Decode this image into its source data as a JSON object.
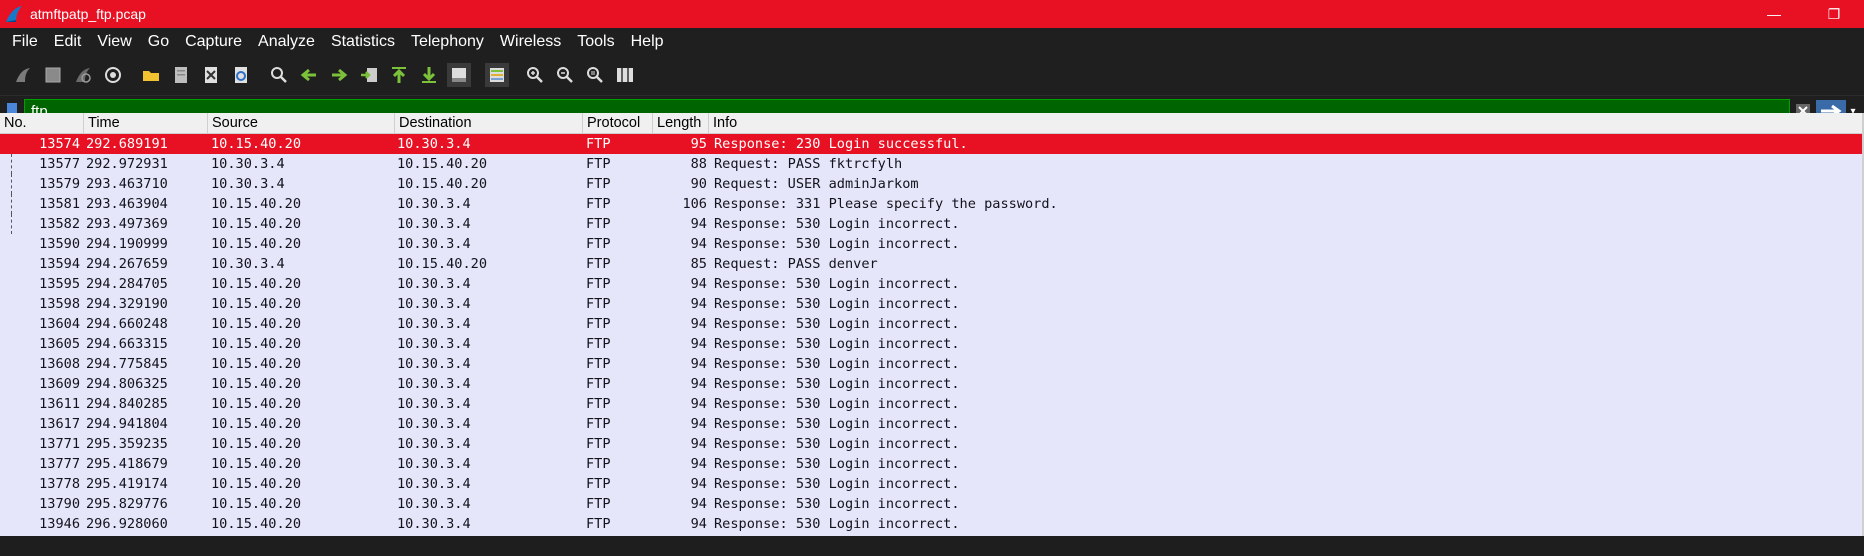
{
  "window": {
    "title": "atmftpatp_ftp.pcap",
    "minimize_glyph": "—",
    "maximize_glyph": "❐"
  },
  "menu": [
    "File",
    "Edit",
    "View",
    "Go",
    "Capture",
    "Analyze",
    "Statistics",
    "Telephony",
    "Wireless",
    "Tools",
    "Help"
  ],
  "filter": {
    "value": "ftp",
    "color": "#006400"
  },
  "columns": [
    "No.",
    "Time",
    "Source",
    "Destination",
    "Protocol",
    "Length",
    "Info"
  ],
  "packets": [
    {
      "no": "13574",
      "time": "292.689191",
      "src": "10.15.40.20",
      "dst": "10.30.3.4",
      "proto": "FTP",
      "len": "95",
      "info": "Response: 230 Login successful.",
      "selected": true
    },
    {
      "no": "13577",
      "time": "292.972931",
      "src": "10.30.3.4",
      "dst": "10.15.40.20",
      "proto": "FTP",
      "len": "88",
      "info": "Request: PASS fktrcfylh"
    },
    {
      "no": "13579",
      "time": "293.463710",
      "src": "10.30.3.4",
      "dst": "10.15.40.20",
      "proto": "FTP",
      "len": "90",
      "info": "Request: USER adminJarkom"
    },
    {
      "no": "13581",
      "time": "293.463904",
      "src": "10.15.40.20",
      "dst": "10.30.3.4",
      "proto": "FTP",
      "len": "106",
      "info": "Response: 331 Please specify the password."
    },
    {
      "no": "13582",
      "time": "293.497369",
      "src": "10.15.40.20",
      "dst": "10.30.3.4",
      "proto": "FTP",
      "len": "94",
      "info": "Response: 530 Login incorrect."
    },
    {
      "no": "13590",
      "time": "294.190999",
      "src": "10.15.40.20",
      "dst": "10.30.3.4",
      "proto": "FTP",
      "len": "94",
      "info": "Response: 530 Login incorrect."
    },
    {
      "no": "13594",
      "time": "294.267659",
      "src": "10.30.3.4",
      "dst": "10.15.40.20",
      "proto": "FTP",
      "len": "85",
      "info": "Request: PASS denver"
    },
    {
      "no": "13595",
      "time": "294.284705",
      "src": "10.15.40.20",
      "dst": "10.30.3.4",
      "proto": "FTP",
      "len": "94",
      "info": "Response: 530 Login incorrect."
    },
    {
      "no": "13598",
      "time": "294.329190",
      "src": "10.15.40.20",
      "dst": "10.30.3.4",
      "proto": "FTP",
      "len": "94",
      "info": "Response: 530 Login incorrect."
    },
    {
      "no": "13604",
      "time": "294.660248",
      "src": "10.15.40.20",
      "dst": "10.30.3.4",
      "proto": "FTP",
      "len": "94",
      "info": "Response: 530 Login incorrect."
    },
    {
      "no": "13605",
      "time": "294.663315",
      "src": "10.15.40.20",
      "dst": "10.30.3.4",
      "proto": "FTP",
      "len": "94",
      "info": "Response: 530 Login incorrect."
    },
    {
      "no": "13608",
      "time": "294.775845",
      "src": "10.15.40.20",
      "dst": "10.30.3.4",
      "proto": "FTP",
      "len": "94",
      "info": "Response: 530 Login incorrect."
    },
    {
      "no": "13609",
      "time": "294.806325",
      "src": "10.15.40.20",
      "dst": "10.30.3.4",
      "proto": "FTP",
      "len": "94",
      "info": "Response: 530 Login incorrect."
    },
    {
      "no": "13611",
      "time": "294.840285",
      "src": "10.15.40.20",
      "dst": "10.30.3.4",
      "proto": "FTP",
      "len": "94",
      "info": "Response: 530 Login incorrect."
    },
    {
      "no": "13617",
      "time": "294.941804",
      "src": "10.15.40.20",
      "dst": "10.30.3.4",
      "proto": "FTP",
      "len": "94",
      "info": "Response: 530 Login incorrect."
    },
    {
      "no": "13771",
      "time": "295.359235",
      "src": "10.15.40.20",
      "dst": "10.30.3.4",
      "proto": "FTP",
      "len": "94",
      "info": "Response: 530 Login incorrect."
    },
    {
      "no": "13777",
      "time": "295.418679",
      "src": "10.15.40.20",
      "dst": "10.30.3.4",
      "proto": "FTP",
      "len": "94",
      "info": "Response: 530 Login incorrect."
    },
    {
      "no": "13778",
      "time": "295.419174",
      "src": "10.15.40.20",
      "dst": "10.30.3.4",
      "proto": "FTP",
      "len": "94",
      "info": "Response: 530 Login incorrect."
    },
    {
      "no": "13790",
      "time": "295.829776",
      "src": "10.15.40.20",
      "dst": "10.30.3.4",
      "proto": "FTP",
      "len": "94",
      "info": "Response: 530 Login incorrect."
    },
    {
      "no": "13946",
      "time": "296.928060",
      "src": "10.15.40.20",
      "dst": "10.30.3.4",
      "proto": "FTP",
      "len": "94",
      "info": "Response: 530 Login incorrect."
    }
  ],
  "colors": {
    "title_bar": "#e81123",
    "row_bg": "#e6e6fa",
    "selected_row": "#e81123"
  }
}
